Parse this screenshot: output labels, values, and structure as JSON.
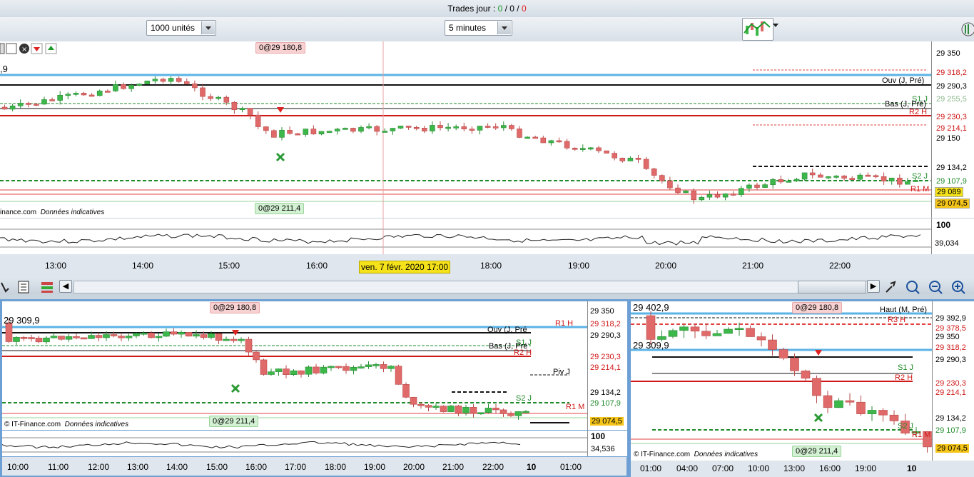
{
  "header": {
    "trades_label": "Trades jour : ",
    "trades_a": "0",
    "trades_sep1": " / ",
    "trades_b": "0",
    "trades_sep2": " / ",
    "trades_c": "0"
  },
  "toolbar": {
    "quantity": "1000 unités",
    "timeframe": "5 minutes"
  },
  "main_chart": {
    "top_order": "0@29 180,8",
    "bottom_order": "0@29 211,4",
    "left_value": ",9",
    "watermark_brand": "inance.com",
    "watermark_note": "Données indicatives",
    "price_ticks": [
      "29 350",
      "29 290,3",
      "29 214,1",
      "29 150",
      "29 134,2",
      "29 107,9"
    ],
    "price_tags": {
      "r1": "29 318,2",
      "r2": "29 230,3",
      "cur": "29 089",
      "low": "29 074,5",
      "tag255": "29 255,5"
    },
    "line_labels": {
      "ouv": "Ouv (J, Pré)",
      "bas": "Bas (J, Pré)",
      "s1": "S1 J",
      "r2": "R2 H",
      "s2": "S2 J",
      "r1m": "R1 M"
    },
    "osc_top": "100",
    "osc_value": "39,034",
    "time_labels": [
      "13:00",
      "14:00",
      "15:00",
      "16:00",
      "18:00",
      "19:00",
      "20:00",
      "21:00",
      "22:00"
    ],
    "cursor_date": "ven. 7 févr. 2020 17:00"
  },
  "left_chart": {
    "top_order": "0@29 180,8",
    "bottom_order": "0@29 211,4",
    "left_value": "29 309,9",
    "watermark_brand": "© IT-Finance.com",
    "watermark_note": "Données indicatives",
    "price_ticks": [
      "29 350",
      "29 318,2",
      "29 290,3",
      "29 230,3",
      "29 214,1",
      "29 134,2",
      "29 107,9",
      "29 074,5"
    ],
    "line_labels": {
      "r1": "R1 H",
      "ouv": "Ouv (J, Pré",
      "bas": "Bas (J, Pré",
      "s1": "S1 J",
      "r2": "R2 H",
      "piv": "Piv J",
      "s2": "S2 J",
      "r1m": "R1 M"
    },
    "osc_top": "100",
    "osc_value": "34,536",
    "time_labels": [
      "10:00",
      "11:00",
      "12:00",
      "13:00",
      "14:00",
      "15:00",
      "16:00",
      "17:00",
      "18:00",
      "19:00",
      "20:00",
      "21:00",
      "22:00",
      "10",
      "01:00"
    ]
  },
  "right_chart": {
    "top_order": "0@29 180,8",
    "bottom_order": "0@29 211,4",
    "left_value_top": "29 402,9",
    "left_value": "29 309,9",
    "watermark_brand": "© IT-Finance.com",
    "watermark_note": "Données indicatives",
    "price_ticks": [
      "29 392,9",
      "29 378,5",
      "29 350",
      "29 318,2",
      "29 290,3",
      "29 230,3",
      "29 214,1",
      "29 134,2",
      "29 107,9",
      "29 074,5"
    ],
    "line_labels": {
      "haut": "Haut (M, Pré)",
      "r3": "R3 H",
      "s1": "S1 J",
      "r2": "R2 H",
      "s2": "S2 J",
      "r1m": "R1 M"
    },
    "time_labels": [
      "01:00",
      "04:00",
      "07:00",
      "10:00",
      "13:00",
      "16:00",
      "19:00",
      "10"
    ]
  },
  "colors": {
    "bull": "#3cb84a",
    "bear": "#e06a6a",
    "pivot_blue": "#5ab3e6",
    "res_red": "#d01818",
    "sup_green": "#1f8a2a",
    "cursor_tag": "#f5e21a"
  }
}
